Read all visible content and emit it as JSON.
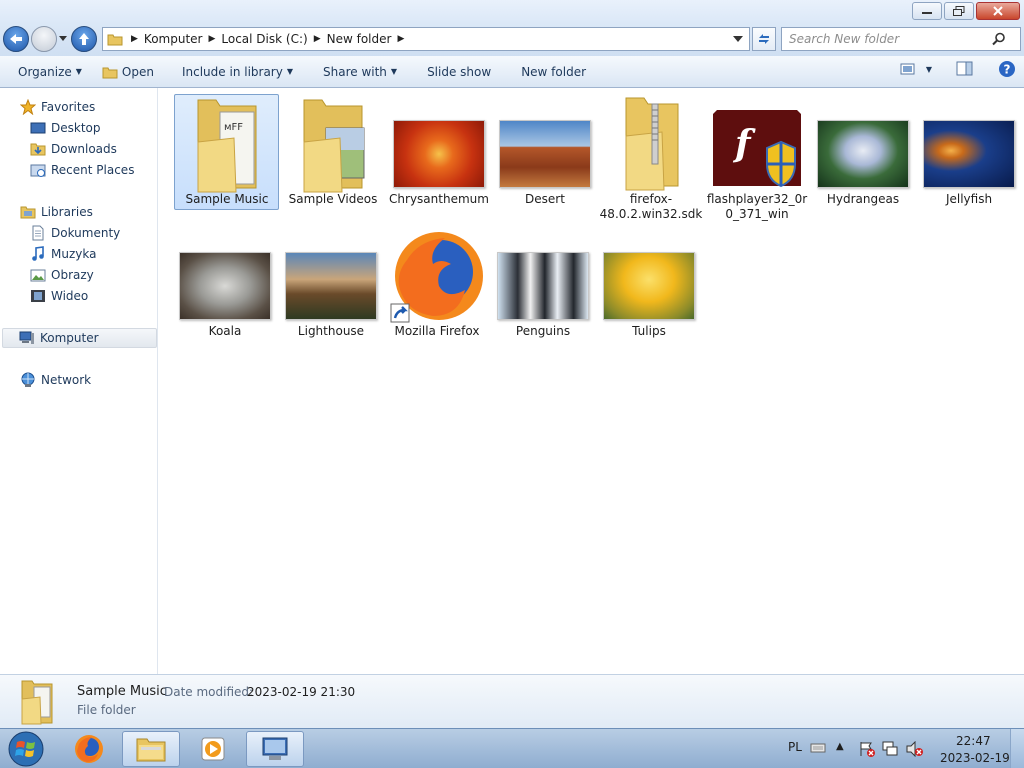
{
  "window": {
    "minimize_icon": "minimize-icon",
    "restore_icon": "restore-icon",
    "close_icon": "close-icon"
  },
  "address": {
    "crumbs": [
      "Komputer",
      "Local Disk (C:)",
      "New folder"
    ],
    "search_placeholder": "Search New folder"
  },
  "toolbar": {
    "organize": "Organize",
    "open": "Open",
    "include_in_library": "Include in library",
    "share_with": "Share with",
    "slide_show": "Slide show",
    "new_folder": "New folder"
  },
  "sidebar": {
    "favorites": "Favorites",
    "desktop": "Desktop",
    "downloads": "Downloads",
    "recent_places": "Recent Places",
    "libraries": "Libraries",
    "dokumenty": "Dokumenty",
    "muzyka": "Muzyka",
    "obrazy": "Obrazy",
    "wideo": "Wideo",
    "komputer": "Komputer",
    "network": "Network"
  },
  "items": [
    {
      "name": "Sample Music",
      "selected": true
    },
    {
      "name": "Sample Videos"
    },
    {
      "name": "Chrysanthemum"
    },
    {
      "name": "Desert"
    },
    {
      "name": "firefox-48.0.2.win32.sdk"
    },
    {
      "name": "flashplayer32_0r0_371_win"
    },
    {
      "name": "Hydrangeas"
    },
    {
      "name": "Jellyfish"
    },
    {
      "name": "Koala"
    },
    {
      "name": "Lighthouse"
    },
    {
      "name": "Mozilla Firefox"
    },
    {
      "name": "Penguins"
    },
    {
      "name": "Tulips"
    }
  ],
  "details": {
    "name": "Sample Music",
    "date_modified_label": "Date modified:",
    "date_modified_value": "2023-02-19 21:30",
    "type": "File folder"
  },
  "taskbar": {
    "language": "PL",
    "time": "22:47",
    "date": "2023-02-19"
  },
  "colors": {
    "accent": "#1e395b",
    "selection": "#c1dbfc",
    "taskbar": "#9fbbdc"
  }
}
